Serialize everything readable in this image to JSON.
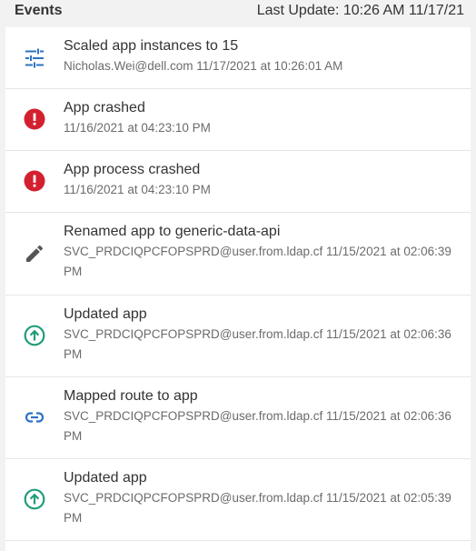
{
  "header": {
    "title": "Events",
    "last_update": "Last Update: 10:26 AM 11/17/21"
  },
  "colors": {
    "primary_blue": "#2c73c3",
    "error_red": "#d3202f",
    "success_green": "#1f9c7a",
    "neutral_gray": "#555555"
  },
  "events": [
    {
      "icon": "sliders-icon",
      "title": "Scaled app instances to 15",
      "meta": "Nicholas.Wei@dell.com 11/17/2021 at 10:26:01 AM"
    },
    {
      "icon": "error-icon",
      "title": "App crashed",
      "meta": "11/16/2021 at 04:23:10 PM"
    },
    {
      "icon": "error-icon",
      "title": "App process crashed",
      "meta": "11/16/2021 at 04:23:10 PM"
    },
    {
      "icon": "pencil-icon",
      "title": "Renamed app to generic-data-api",
      "meta": "SVC_PRDCIQPCFOPSPRD@user.from.ldap.cf 11/15/2021 at 02:06:39 PM"
    },
    {
      "icon": "arrow-up-circle-icon",
      "title": "Updated app",
      "meta": "SVC_PRDCIQPCFOPSPRD@user.from.ldap.cf 11/15/2021 at 02:06:36 PM"
    },
    {
      "icon": "link-icon",
      "title": "Mapped route to app",
      "meta": "SVC_PRDCIQPCFOPSPRD@user.from.ldap.cf 11/15/2021 at 02:06:36 PM"
    },
    {
      "icon": "arrow-up-circle-icon",
      "title": "Updated app",
      "meta": "SVC_PRDCIQPCFOPSPRD@user.from.ldap.cf 11/15/2021 at 02:05:39 PM"
    }
  ]
}
